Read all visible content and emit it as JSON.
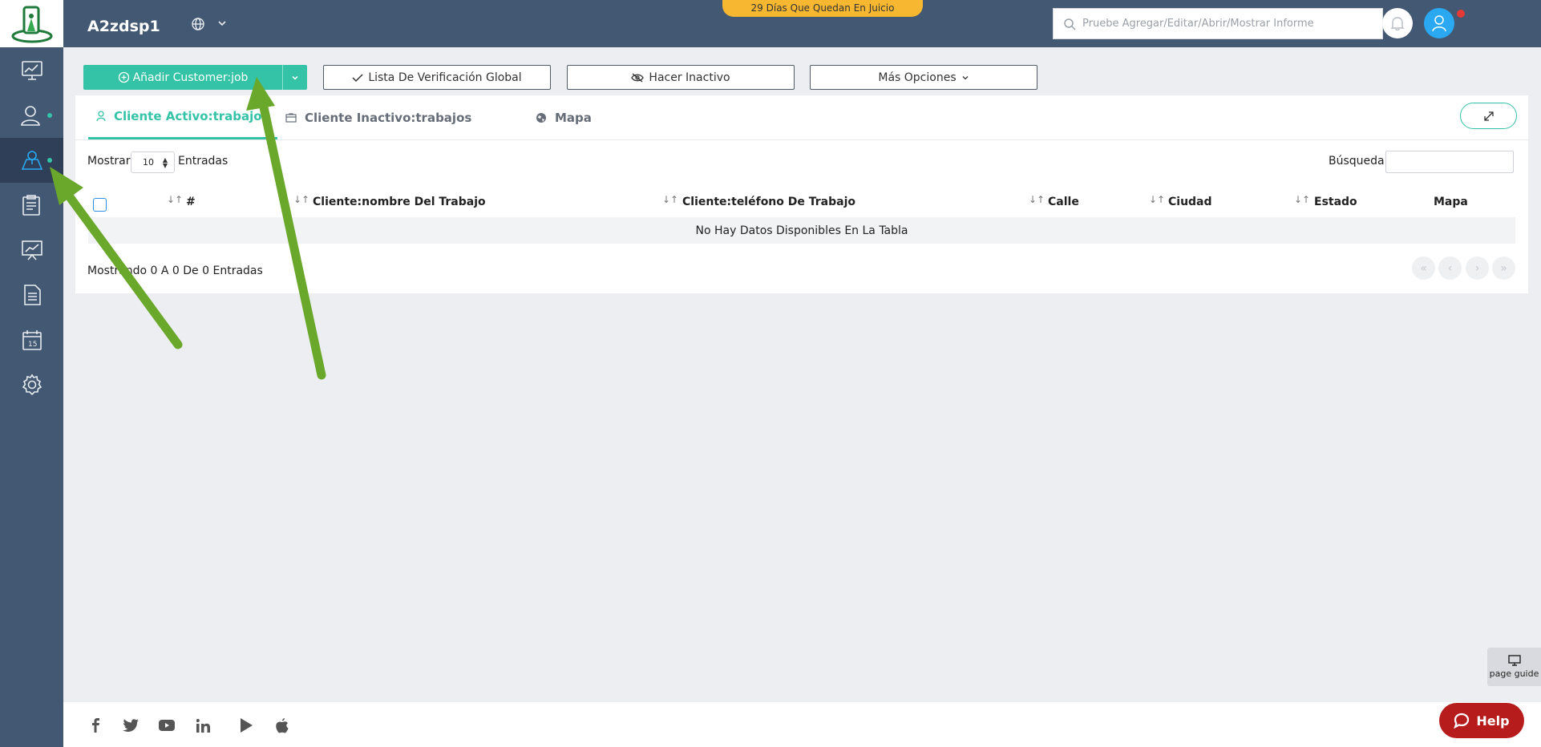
{
  "topbar": {
    "account_name": "A2zdsp1",
    "trial_banner": "29 Días Que Quedan En Juicio",
    "search_placeholder": "Pruebe Agregar/Editar/Abrir/Mostrar Informe"
  },
  "sidebar": {
    "items": [
      {
        "name": "dashboard",
        "icon": "monitor-chart-icon",
        "active": false,
        "dot": false
      },
      {
        "name": "customers",
        "icon": "user-icon",
        "active": false,
        "dot": true
      },
      {
        "name": "customer-jobs",
        "icon": "map-user-icon",
        "active": true,
        "dot": true
      },
      {
        "name": "work-orders",
        "icon": "clipboard-list-icon",
        "active": false,
        "dot": false
      },
      {
        "name": "reports",
        "icon": "presentation-chart-icon",
        "active": false,
        "dot": false
      },
      {
        "name": "documents",
        "icon": "document-icon",
        "active": false,
        "dot": false
      },
      {
        "name": "calendar",
        "icon": "calendar-icon",
        "active": false,
        "dot": false
      },
      {
        "name": "settings",
        "icon": "gear-icon",
        "active": false,
        "dot": false
      }
    ]
  },
  "actions": {
    "add_label": "Añadir Customer:job",
    "checklist_label": "Lista De Verificación Global",
    "inactive_label": "Hacer Inactivo",
    "more_label": "Más Opciones"
  },
  "tabs": [
    {
      "label": "Cliente Activo:trabajos",
      "icon": "user-icon",
      "active": true
    },
    {
      "label": "Cliente Inactivo:trabajos",
      "icon": "archive-icon",
      "active": false
    },
    {
      "label": "Mapa",
      "icon": "globe-icon",
      "active": false
    }
  ],
  "table": {
    "show_label": "Mostrar",
    "page_length": "10",
    "entries_label": "Entradas",
    "search_label": "Búsqueda:",
    "columns": [
      "#",
      "Cliente:nombre Del Trabajo",
      "Cliente:teléfono De Trabajo",
      "Calle",
      "Ciudad",
      "Estado",
      "Mapa"
    ],
    "empty_message": "No Hay Datos Disponibles En La Tabla",
    "info": "Mostrando 0 A 0 De 0 Entradas"
  },
  "page_guide_label": "page guide",
  "help_label": "Help",
  "colors": {
    "sidebar": "#435872",
    "accent": "#35c3a8",
    "banner": "#f8b731",
    "help": "#b71c1c",
    "annotation_arrow": "#6aa82c"
  }
}
